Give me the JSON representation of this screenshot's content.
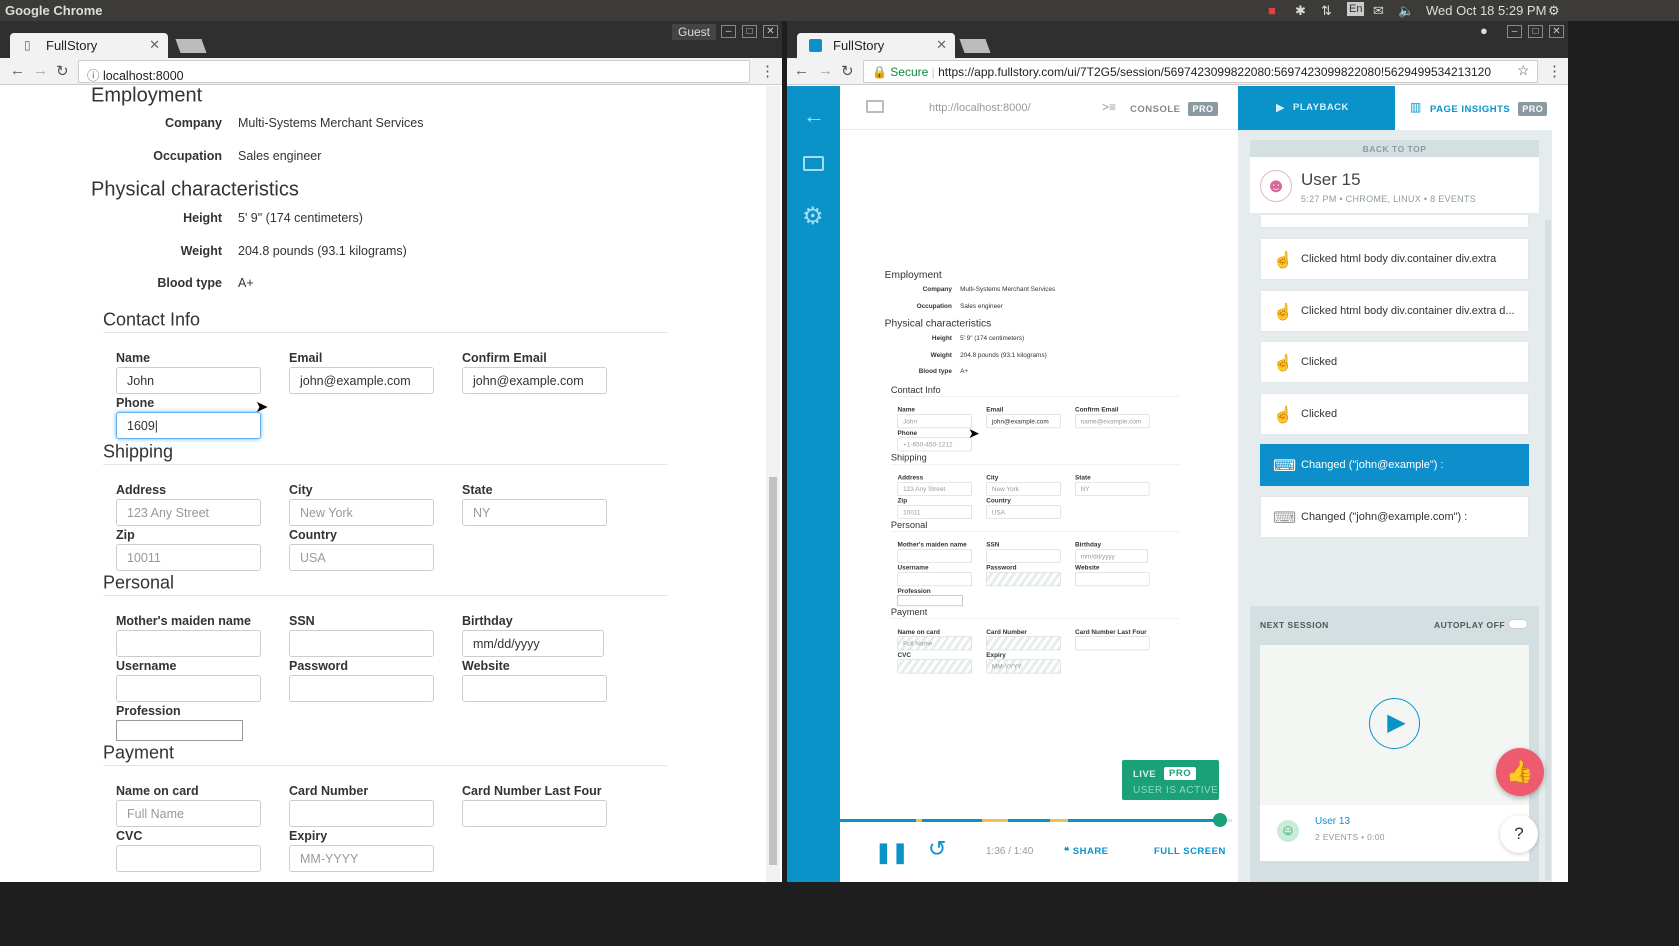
{
  "os": {
    "app_name": "Google Chrome",
    "clock": "Wed Oct 18  5:29 PM",
    "lang": "En"
  },
  "left_window": {
    "tab_title": "FullStory",
    "guest_label": "Guest",
    "url": "localhost:8000"
  },
  "right_window": {
    "tab_title": "FullStory",
    "secure_label": "Secure",
    "url": "https://app.fullstory.com/ui/7T2G5/session/5697423099822080:5697423099822080!5629499534213120"
  },
  "form": {
    "kv_sections": [
      {
        "title": "Employment",
        "rows": [
          {
            "label": "Company",
            "value": "Multi-Systems Merchant Services"
          },
          {
            "label": "Occupation",
            "value": "Sales engineer"
          }
        ]
      },
      {
        "title": "Physical characteristics",
        "rows": [
          {
            "label": "Height",
            "value": "5' 9\" (174 centimeters)"
          },
          {
            "label": "Weight",
            "value": "204.8 pounds (93.1 kilograms)"
          },
          {
            "label": "Blood type",
            "value": "A+"
          }
        ]
      }
    ],
    "field_sections": [
      {
        "title": "Contact Info",
        "fields": [
          {
            "label": "Name",
            "value": "John"
          },
          {
            "label": "Email",
            "value": "john@example.com"
          },
          {
            "label": "Confirm Email",
            "value": "john@example.com"
          },
          {
            "label": "Phone",
            "value": "1609",
            "focused": true
          }
        ]
      },
      {
        "title": "Shipping",
        "fields": [
          {
            "label": "Address",
            "placeholder": "123 Any Street"
          },
          {
            "label": "City",
            "placeholder": "New York"
          },
          {
            "label": "State",
            "placeholder": "NY"
          },
          {
            "label": "Zip",
            "placeholder": "10011"
          },
          {
            "label": "Country",
            "placeholder": "USA"
          }
        ]
      },
      {
        "title": "Personal",
        "fields": [
          {
            "label": "Mother's maiden name"
          },
          {
            "label": "SSN"
          },
          {
            "label": "Birthday",
            "value": "mm/dd/yyyy"
          },
          {
            "label": "Username"
          },
          {
            "label": "Password"
          },
          {
            "label": "Website"
          },
          {
            "label": "Profession"
          }
        ]
      },
      {
        "title": "Payment",
        "fields": [
          {
            "label": "Name on card",
            "placeholder": "Full Name"
          },
          {
            "label": "Card Number"
          },
          {
            "label": "Card Number Last Four"
          },
          {
            "label": "CVC"
          },
          {
            "label": "Expiry",
            "placeholder": "MM-YYYY"
          }
        ]
      }
    ]
  },
  "replay_form": {
    "kv_sections": [
      {
        "title": "Employment",
        "rows": [
          {
            "label": "Company",
            "value": "Multi-Systems Merchant Services"
          },
          {
            "label": "Occupation",
            "value": "Sales engineer"
          }
        ]
      },
      {
        "title": "Physical characteristics",
        "rows": [
          {
            "label": "Height",
            "value": "5' 9\" (174 centimeters)"
          },
          {
            "label": "Weight",
            "value": "204.8 pounds (93.1 kilograms)"
          },
          {
            "label": "Blood type",
            "value": "A+"
          }
        ]
      }
    ],
    "field_sections": [
      {
        "title": "Contact Info",
        "fields": [
          {
            "label": "Name",
            "placeholder": "John"
          },
          {
            "label": "Email",
            "value": "john@example.com"
          },
          {
            "label": "Confirm Email",
            "placeholder": "name@example.com"
          },
          {
            "label": "Phone",
            "placeholder": "+1-650-450-1212"
          }
        ]
      },
      {
        "title": "Shipping",
        "fields": [
          {
            "label": "Address",
            "placeholder": "123 Any Street"
          },
          {
            "label": "City",
            "placeholder": "New York"
          },
          {
            "label": "State",
            "placeholder": "NY"
          },
          {
            "label": "Zip",
            "placeholder": "10011"
          },
          {
            "label": "Country",
            "placeholder": "USA"
          }
        ]
      },
      {
        "title": "Personal",
        "fields": [
          {
            "label": "Mother's maiden name"
          },
          {
            "label": "SSN"
          },
          {
            "label": "Birthday",
            "placeholder": "mm/dd/yyyy"
          },
          {
            "label": "Username"
          },
          {
            "label": "Password",
            "masked": true
          },
          {
            "label": "Website"
          },
          {
            "label": "Profession"
          }
        ]
      },
      {
        "title": "Payment",
        "fields": [
          {
            "label": "Name on card",
            "placeholder": "Full Name",
            "masked": true
          },
          {
            "label": "Card Number",
            "masked": true
          },
          {
            "label": "Card Number Last Four"
          },
          {
            "label": "CVC",
            "masked": true
          },
          {
            "label": "Expiry",
            "placeholder": "MM-YYYY",
            "masked": true
          }
        ]
      }
    ]
  },
  "fullstory": {
    "page_url": "http://localhost:8000/",
    "console_label": "CONSOLE",
    "pro_badge": "PRO",
    "playback_label": "PLAYBACK",
    "page_insights_label": "PAGE INSIGHTS",
    "back_to_top": "BACK TO TOP",
    "user": {
      "name": "User 15",
      "meta": "5:27 PM • CHROME, LINUX • 8 EVENTS"
    },
    "events": [
      {
        "icon": "click",
        "text": "Clicked html body div.container div.extra",
        "active": false
      },
      {
        "icon": "click",
        "text": "Clicked html body div.container div.extra d...",
        "active": false
      },
      {
        "icon": "click",
        "text": "Clicked",
        "active": false
      },
      {
        "icon": "click",
        "text": "Clicked",
        "active": false
      },
      {
        "icon": "keyboard",
        "text": "Changed (\"john@example\") :",
        "active": true
      },
      {
        "icon": "keyboard",
        "text": "Changed (\"john@example.com\") :",
        "active": false
      }
    ],
    "live": {
      "label": "LIVE",
      "pro": "PRO",
      "status": "USER IS ACTIVE"
    },
    "next_session": {
      "label": "NEXT SESSION",
      "autoplay": "AUTOPLAY OFF",
      "user": "User 13",
      "meta": "2 EVENTS • 0:00"
    },
    "player": {
      "time": "1:36 / 1:40",
      "share": "SHARE",
      "fullscreen": "FULL SCREEN",
      "progress": 0.97
    },
    "help": "?"
  }
}
